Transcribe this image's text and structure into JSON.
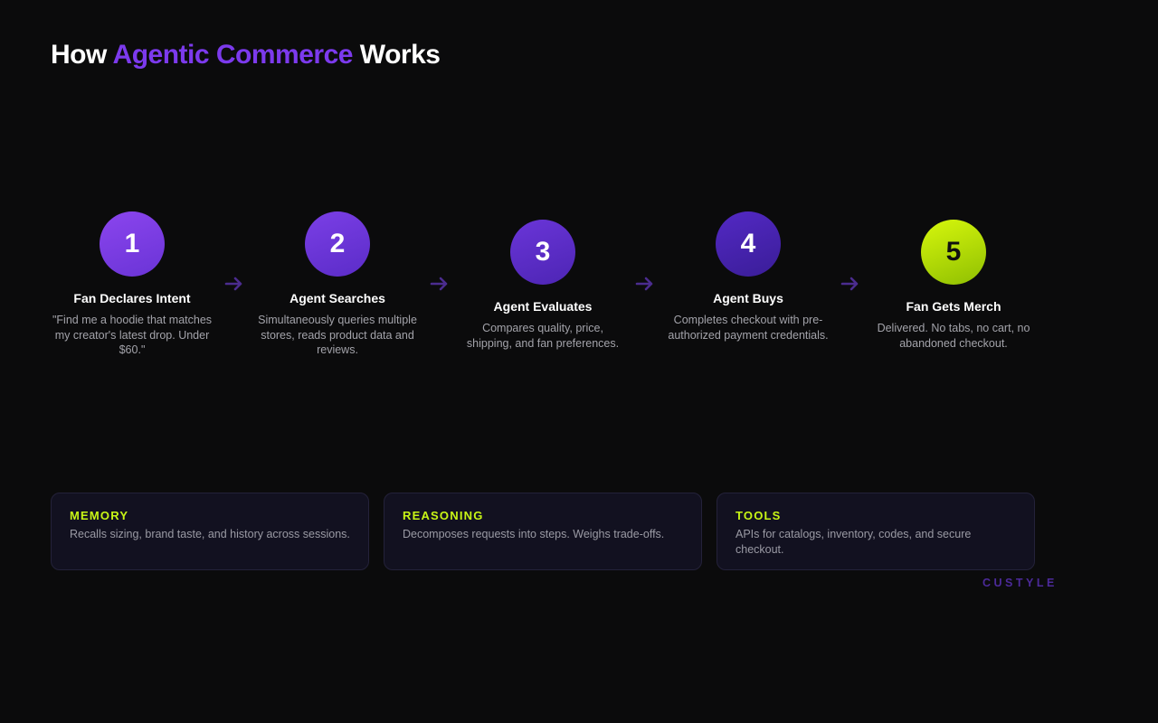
{
  "header": {
    "title_pre": "How ",
    "title_accent": "Agentic Commerce",
    "title_post": " Works"
  },
  "colors": {
    "accent_purple": "#7c3aed",
    "accent_lime": "#c8f516",
    "background": "#0b0b0c"
  },
  "steps": [
    {
      "number": "1",
      "title": "Fan Declares Intent",
      "description": "\"Find me a hoodie that matches my creator's latest drop. Under $60.\""
    },
    {
      "number": "2",
      "title": "Agent Searches",
      "description": "Simultaneously queries multiple stores, reads product data and reviews."
    },
    {
      "number": "3",
      "title": "Agent Evaluates",
      "description": "Compares quality, price, shipping, and fan preferences."
    },
    {
      "number": "4",
      "title": "Agent Buys",
      "description": "Completes checkout with pre-authorized payment credentials."
    },
    {
      "number": "5",
      "title": "Fan Gets Merch",
      "description": "Delivered. No tabs, no cart, no abandoned checkout."
    }
  ],
  "arrow_icon": "arrow-right-icon",
  "cards": [
    {
      "label": "MEMORY",
      "text": "Recalls sizing, brand taste, and history across sessions."
    },
    {
      "label": "REASONING",
      "text": "Decomposes requests into steps. Weighs trade-offs."
    },
    {
      "label": "TOOLS",
      "text": "APIs for catalogs, inventory, codes, and secure checkout."
    }
  ],
  "brand": {
    "name": "CUSTYLE"
  }
}
